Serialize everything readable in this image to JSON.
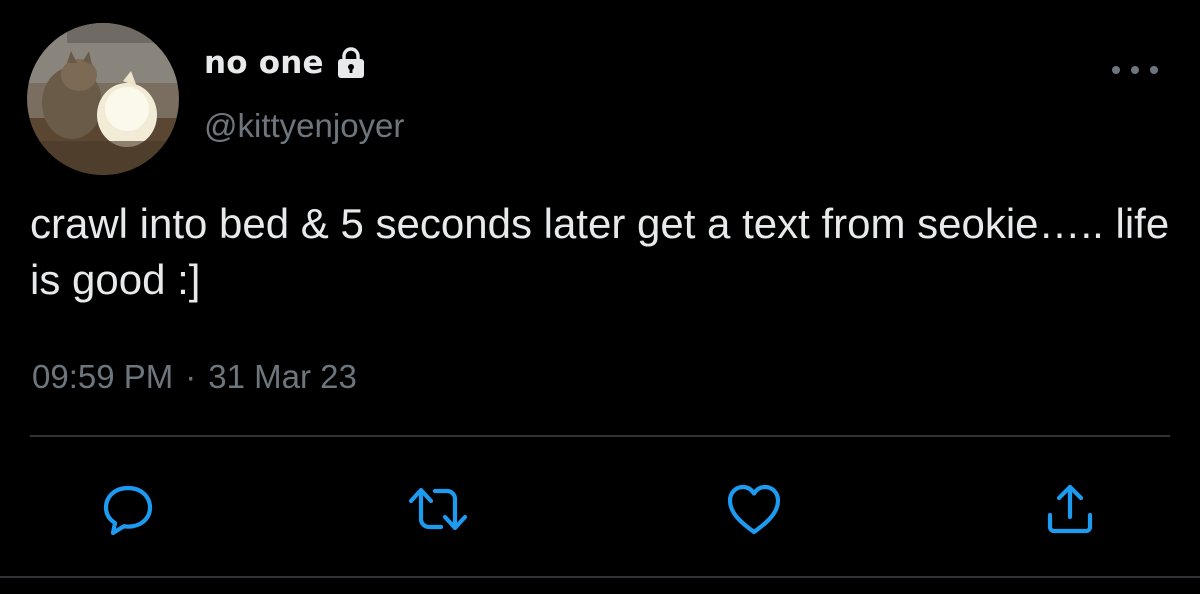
{
  "tweet": {
    "display_name": "no one",
    "handle": "@kittyenjoyer",
    "text": "crawl into bed & 5 seconds later get a text from seokie….. life is good :]",
    "time": "09:59 PM",
    "separator": "·",
    "date": "31 Mar 23",
    "protected": true
  },
  "icons": {
    "lock": "lock-icon",
    "more": "more-icon",
    "reply": "reply-icon",
    "retweet": "retweet-icon",
    "like": "heart-icon",
    "share": "share-icon"
  },
  "colors": {
    "background": "#000000",
    "text_primary": "#e7e9ea",
    "text_secondary": "#6e767d",
    "action_icon": "#1d9bf0",
    "divider": "#2f3336"
  }
}
